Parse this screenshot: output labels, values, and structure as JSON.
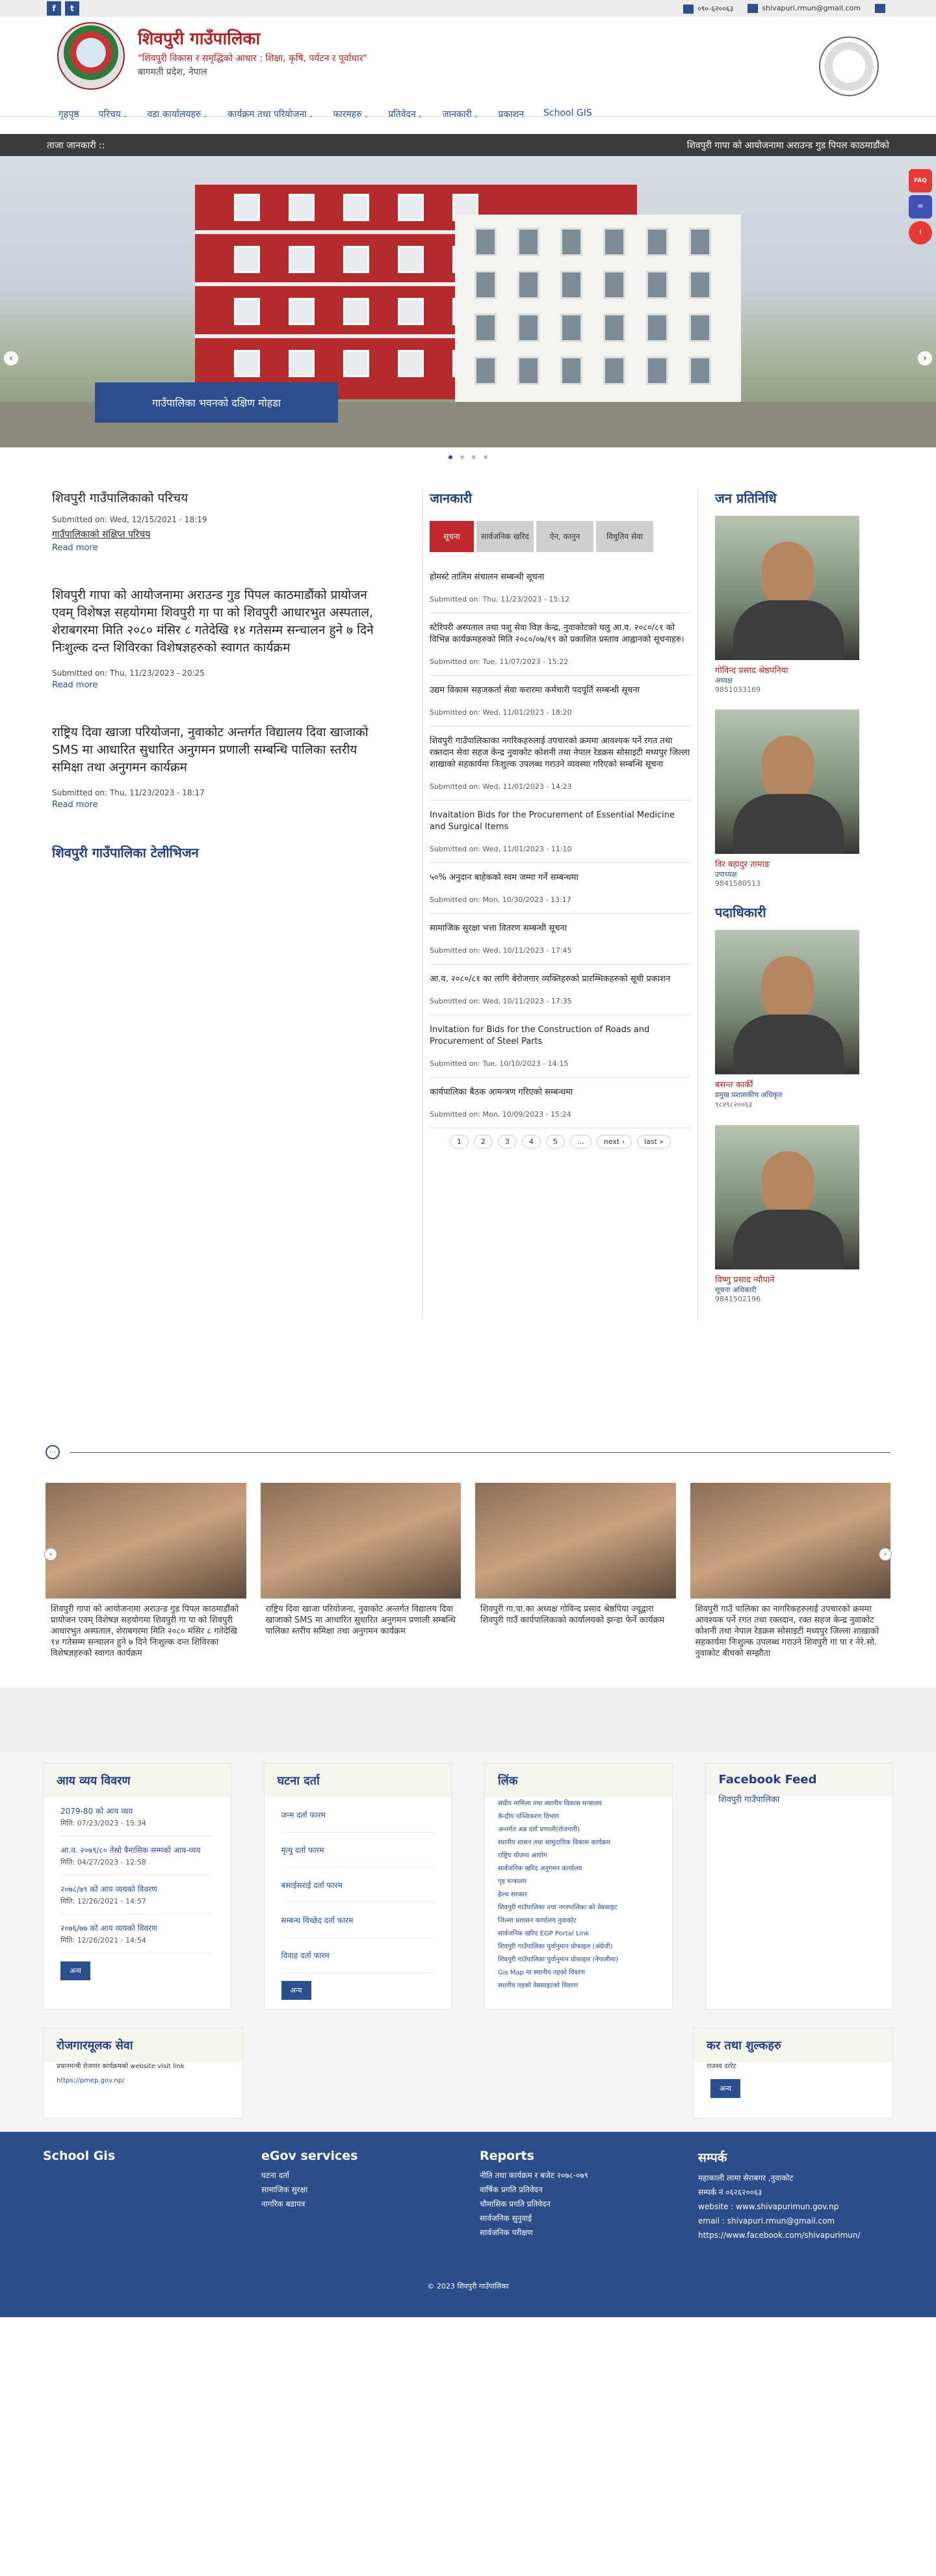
{
  "topbar": {
    "phone": "०९०-६२००६३",
    "email": "shivapuri.rmun@gmail.com",
    "facebook": "f",
    "twitter": "t"
  },
  "header": {
    "name": "शिवपुरी गाउँपालिका",
    "slogan": "\"शिवपुरी विकास र समृद्धिको आधार : शिक्षा, कृषि, पर्यटन र पूर्वाधार\"",
    "province": "बागमती प्रदेश, नेपाल"
  },
  "nav": [
    {
      "label": "गृहपृष्ठ",
      "dd": false
    },
    {
      "label": "परिचय",
      "dd": true
    },
    {
      "label": "वडा कार्यालयहरु",
      "dd": true
    },
    {
      "label": "कार्यक्रम तथा परियोजना",
      "dd": true
    },
    {
      "label": "फारमहरु",
      "dd": true
    },
    {
      "label": "प्रतिवेदन",
      "dd": true
    },
    {
      "label": "जानकारी",
      "dd": true
    },
    {
      "label": "प्रकाशन",
      "dd": false
    },
    {
      "label": "School GIS",
      "dd": false
    }
  ],
  "ticker": {
    "label": "ताजा जानकारी ::",
    "text": "शिवपुरी गापा को आयोजनामा अराउन्ड गुड पिपल काठमाडौंको"
  },
  "hero": {
    "caption": "गाउँपालिका भवनको दक्षिण मोहडा",
    "prev": "‹",
    "next": "›",
    "side": [
      "FAQ",
      "✉",
      "!"
    ]
  },
  "intro": {
    "title": "शिवपुरी गाउँपालिकाको परिचय",
    "sub": "Submitted on: Wed, 12/15/2021 - 18:19",
    "link": "गाउँपालिकाको संक्षिप्त परिचय"
  },
  "articles": [
    {
      "title": "शिवपुरी गापा को आयोजनामा अराउन्ड गुड पिपल काठमाडौंको प्रायोजन एवम् विशेषज्ञ सहयोगमा शिवपुरी गा पा को शिवपुरी आधारभुत अस्पताल, शेराबगरमा मिति २०८० मंसिर ८ गतेदेखि १४ गतेसम्म सन्चालन हुने ७ दिने निःशुल्क दन्त शिविरका विशेषज्ञहरुको स्वागत कार्यक्रम",
      "sub": "Submitted on: Thu, 11/23/2023 - 20:25",
      "more": "Read more"
    },
    {
      "title": "राष्ट्रिय दिवा खाजा परियोजना, नुवाकोट अन्तर्गत विद्यालय दिवा खाजाको SMS मा आधारित सुधारित अनुगमन प्रणाली सम्बन्धि पालिका स्तरीय समिक्षा तथा अनुगमन कार्यक्रम",
      "sub": "Submitted on: Thu, 11/23/2023 - 18:17",
      "more": "Read more"
    }
  ],
  "readmore": "Read more",
  "tv_title": "शिवपुरी गाउँपालिका टेलीभिजन",
  "janakari": {
    "title": "जानकारी",
    "tabs": [
      "सूचना",
      "सार्वजनिक खरिद",
      "ऐन, कानुन",
      "विधुतिय सेवा"
    ],
    "items": [
      {
        "t": "होमस्टे तालिम संचालन सम्बन्धी सूचना",
        "d": "Submitted on: Thu, 11/23/2023 - 15:12"
      },
      {
        "t": "स्टेरिपरी अस्पताल तथा पशु सेवा विज्ञ केन्द्र, नुवाकोटको घलु आ.व. २०८०/८१ को विभिन्न कार्यक्रमहरुको मिति २०८०/०७/१९ को प्रकाशित प्रस्ताव आह्वानको सूचनाहरु।",
        "d": "Submitted on: Tue, 11/07/2023 - 15:22"
      },
      {
        "t": "उद्यम विकास सहजकर्ता सेवा करारमा कर्मचारी पदपूर्ति सम्बन्धी सूचना",
        "d": "Submitted on: Wed, 11/01/2023 - 18:20"
      },
      {
        "t": "शिवपुरी गाउँपालिकाका नगरिकहरुलाई उपचारको क्रममा आवश्यक पर्ने रगत तथा रक्तदान सेवा सहज केन्द्र नुवाकोट कोशनी तथा नेपाल रेडक्रस सोसाइटी मध्यपुर जिल्ला शाखाको सहकार्यमा निःशुल्क उपलब्ध गराउने व्यवस्था गरिएको सम्बन्धि सूचना",
        "d": "Submitted on: Wed, 11/01/2023 - 14:23"
      },
      {
        "t": "Invaitation Bids for the Procurement of Essential Medicine and Surgical Items",
        "d": "Submitted on: Wed, 11/01/2023 - 11:10"
      },
      {
        "t": "५०% अनुदान बाहेकको स्वम जम्मा गर्ने सम्बन्धमा",
        "d": "Submitted on: Mon, 10/30/2023 - 13:17"
      },
      {
        "t": "सामाजिक सुरक्षा भत्ता वितरण सम्बन्धी सूचना",
        "d": "Submitted on: Wed, 10/11/2023 - 17:45"
      },
      {
        "t": "आ.व. २०८०/८१ का लागि बेरोजगार व्यक्तिहरुको प्रारम्भिकहरुको सूची प्रकाशन",
        "d": "Submitted on: Wed, 10/11/2023 - 17:35"
      },
      {
        "t": "Invitation for Bids for the Construction of Roads and Procurement of Steel Parts",
        "d": "Submitted on: Tue, 10/10/2023 - 14:15"
      },
      {
        "t": "कार्यपालिका बैठक आमन्त्रण गरिएको सम्बन्धमा",
        "d": "Submitted on: Mon, 10/09/2023 - 15:24"
      }
    ],
    "pager": [
      "1",
      "2",
      "3",
      "4",
      "5",
      "…",
      "next ›",
      "last »"
    ]
  },
  "reps": {
    "title": "जन प्रतिनिधि",
    "people": [
      {
        "name": "गोविन्द प्रसाद श्रेष्ठपनिया",
        "role": "अध्यक्ष",
        "ph": "9851033169"
      },
      {
        "name": "विर बहादुर तामाङ",
        "role": "उपाध्यक्ष",
        "ph": "9841580513"
      }
    ],
    "officials_title": "पदाधिकारी",
    "officials": [
      {
        "name": "बसन्त कार्की",
        "role": "प्रमुख प्रशासकीय अधिकृत",
        "ph": "९८४९८२००६३"
      },
      {
        "name": "विष्णु प्रसाद न्यौपाने",
        "role": "सूचना अधिकारी",
        "ph": "9841502196"
      }
    ]
  },
  "gallery": {
    "icon": "⋯",
    "items": [
      "शिवपुरी गापा को आयोजनामा अराउन्ड गुड पिपल काठमाडौंको प्रायोजन एवम् विशेषज्ञ सहयोगमा शिवपुरी गा पा को शिवपुरी आधारभुत अस्पताल, शेराबगरमा मिति २०८० मंसिर ८ गतेदेखि १४ गतेसम्म सन्चालन हुने ७ दिने निःशुल्क दन्त शिविरका विशेषज्ञहरुको स्वागत कार्यक्रम",
      "राष्ट्रिय दिवा खाजा परियोजना, नुवाकोट अन्तर्गत विद्यालय दिवा खाजाको SMS मा आधारित सुधारित अनुगमन प्रणाली सम्बन्धि पालिका स्तरीय समिक्षा तथा अनुगमन कार्यक्रम",
      "शिवपुरी गा.पा.का अध्यक्ष गोविन्द प्रसाद श्रेष्ठपिया ज्यूद्वारा शिवपुरी गाउँ कार्यपालिकाको कार्यालयको झन्डा फेर्ने कार्यक्रम",
      "शिवपुरी गाउँ पालिका का नागरिकहरुलाई उपचारको क्रममा आवश्यक पर्ने रगत तथा रक्तदान, रक्त सहज केन्द्र नुवाकोट कोशनी तथा नेपाल रेडक्रस सोसाइटी मध्यपुर जिल्ला शाखाको सहकार्यमा निःशुल्क उपलब्ध गराउने शिवपुरी गा पा र नेरे.सो. नुवाकोट बीचको सम्झौता"
    ]
  },
  "cards": {
    "income": {
      "title": "आय व्यय विवरण",
      "items": [
        {
          "l": "2079-80 को आय व्यय",
          "d": "मिति: 07/23/2023 - 15:34"
        },
        {
          "l": "आ.व. २०७९/८० तेस्रो त्रैमासिक सम्मको आय-व्यय",
          "d": "मिति: 04/27/2023 - 12:58"
        },
        {
          "l": "२०७८/७९ को आय व्ययको विवरण",
          "d": "मिति: 12/26/2021 - 14:57"
        },
        {
          "l": "२०७६/७७ को आय व्ययको विवरण",
          "d": "मिति: 12/26/2021 - 14:54"
        }
      ],
      "btn": "अन्य"
    },
    "ghatana": {
      "title": "घटना दर्ता",
      "items": [
        "जन्म दर्ता फारम",
        "मृत्यु दर्ता फारम",
        "बसाईसराई दर्ता फारम",
        "सम्बन्ध विच्छेद दर्ता फारम",
        "विवाह दर्ता फारम"
      ],
      "btn": "अन्य"
    },
    "link": {
      "title": "लिंक",
      "items": [
        "संघीय मामिला तथा स्थानीय विकास मन्त्रालय",
        "केन्द्रीय पञ्जिकरण विभाग",
        "अन्तर्गत अन्न दर्ता प्रणाली(रोजगारी)",
        "स्थानीय शासन तथा सामुदायिक विकास कार्यक्रम",
        "राष्ट्रिय योजना आयोग",
        "सार्वजनिक खरिद अनुगमन कार्यालय",
        "गृह मन्त्रालय",
        "हेल्थ सरकार",
        "शिवपुरी गाउँपालिका तथा नगरपालिका को वेबसाइट",
        "जिल्ला प्रशासन कार्यालय नुवाकोट",
        "सार्वजनिक खरिद EGP Portal Link",
        "शिवपुरी गाउँपालिका पुर्वानुमान प्रोफाइल (अंग्रेजी)",
        "शिवपुरी गाउँपालिका पुर्वानुमान प्रोफाइल (नेपालीमा)",
        "Gis Map मा स्थानीय तहको विवरण",
        "स्थानीय तहको वेबसाइटको विवरण"
      ]
    },
    "facebook": {
      "title": "Facebook Feed",
      "page": "शिवपुरी गाउँपालिका"
    },
    "rojgar": {
      "title": "रोजगारमूलक सेवा",
      "text": "प्रधानमन्त्री रोजगार कार्यक्रमको website visit link",
      "link": "https://pmep.gov.np/"
    },
    "kar": {
      "title": "कर तथा शुल्कहरु",
      "item": "राजश्व दररेट",
      "btn": "अन्य"
    }
  },
  "footer": {
    "cols": [
      {
        "title": "School Gis",
        "items": []
      },
      {
        "title": "eGov services",
        "items": [
          "घटना दर्ता",
          "सामाजिक सुरक्षा",
          "नागरिक बडापत्र"
        ]
      },
      {
        "title": "Reports",
        "items": [
          "नीति तथा कार्यक्रम र बजेट २०७८-०७९",
          "वार्षिक प्रगति प्रतिवेदन",
          "चौमासिक प्रगति प्रतिवेदन",
          "सार्वजनिक सुनुवाई",
          "सार्वजनिक परीक्षण"
        ]
      },
      {
        "title": "सम्पर्क",
        "items": [
          "महाकाली लामा सेराबगर ,नुवाकोट",
          "सम्पर्क नं ०६२६२००६३",
          "website : www.shivapurimun.gov.np",
          "email : shivapuri.rmun@gmail.com",
          "https://www.facebook.com/shivapurimun/"
        ]
      }
    ],
    "copy": "© 2023 शिवपुरी गाउँपालिका"
  }
}
